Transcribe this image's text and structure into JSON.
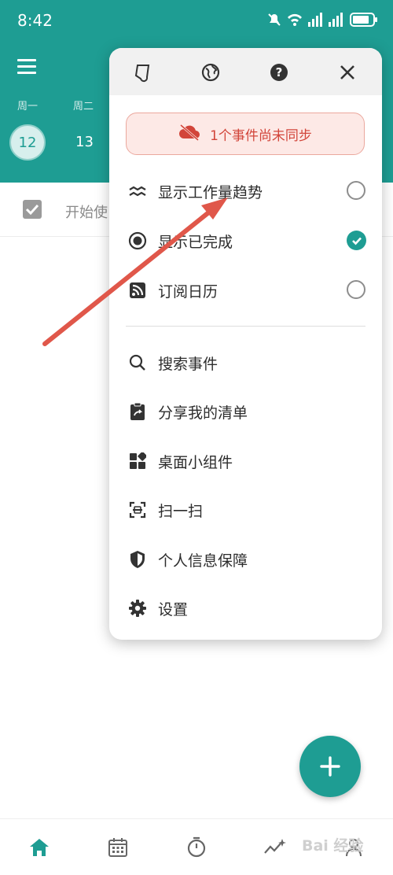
{
  "status_bar": {
    "time": "8:42"
  },
  "week": {
    "weekdays": [
      "周一",
      "周二"
    ],
    "days": [
      "12",
      "13"
    ]
  },
  "task": {
    "text": "开始使"
  },
  "popup": {
    "sync_banner": "1个事件尚未同步",
    "toggles": [
      {
        "label": "显示工作量趋势",
        "icon": "trend-icon",
        "checked": false
      },
      {
        "label": "显示已完成",
        "icon": "radio-dot-icon",
        "checked": true
      },
      {
        "label": "订阅日历",
        "icon": "rss-icon",
        "checked": false
      }
    ],
    "actions": [
      {
        "label": "搜索事件",
        "icon": "search-icon"
      },
      {
        "label": "分享我的清单",
        "icon": "clipboard-share-icon"
      },
      {
        "label": "桌面小组件",
        "icon": "widgets-icon"
      },
      {
        "label": "扫一扫",
        "icon": "scan-icon"
      },
      {
        "label": "个人信息保障",
        "icon": "shield-icon"
      },
      {
        "label": "设置",
        "icon": "gear-icon"
      }
    ]
  },
  "bottom_nav": [
    "home-icon",
    "calendar-icon",
    "timer-icon",
    "sparkle-icon",
    "profile-icon"
  ],
  "watermark": "Bai 经验",
  "colors": {
    "accent": "#1e9d93",
    "alert": "#d2453a",
    "arrow": "#e0574a"
  }
}
